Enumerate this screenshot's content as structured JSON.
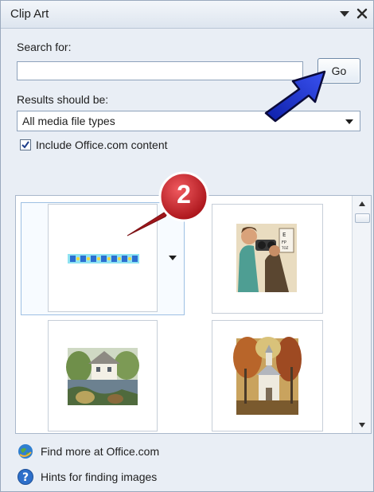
{
  "panel": {
    "title": "Clip Art",
    "search_label": "Search for:",
    "search_value": "",
    "go_label": "Go",
    "results_label": "Results should be:",
    "media_type": "All media file types",
    "include_label": "Include Office.com content",
    "include_checked": true
  },
  "results": {
    "items": [
      {
        "name": "clip-decorative-border",
        "selected": true
      },
      {
        "name": "clip-optometrist"
      },
      {
        "name": "clip-cottage-by-pond"
      },
      {
        "name": "clip-church-in-autumn"
      }
    ]
  },
  "links": {
    "find_more": "Find more at Office.com",
    "hints": "Hints for finding images"
  },
  "annotation": {
    "step_number": "2",
    "badge_color": "#c8181e",
    "arrow_color": "#1a2fd6"
  }
}
